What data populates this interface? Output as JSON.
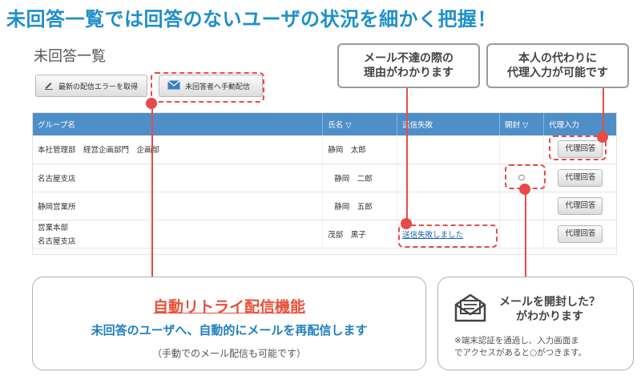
{
  "headline": "未回答一覧では回答のないユーザの状況を細かく把握！",
  "panel": {
    "title": "未回答一覧",
    "buttons": {
      "get_errors": "最新の配信エラーを取得",
      "manual_send": "未回答者へ手動配信"
    }
  },
  "table": {
    "headers": {
      "group": "グループ名",
      "name": "氏名 ▽",
      "fail": "送信失敗",
      "opened": "開封 ▽",
      "proxy": "代理入力"
    },
    "rows": [
      {
        "group_line1": "本社管理部　経営企画部門　企画部",
        "group_line2": "",
        "name": "静岡　太郎",
        "fail": "",
        "opened": "",
        "proxy": "代理回答"
      },
      {
        "group_line1": "名古屋支店",
        "group_line2": "",
        "name": "静岡　二郎",
        "fail": "",
        "opened": "○",
        "proxy": "代理回答"
      },
      {
        "group_line1": "静岡営業所",
        "group_line2": "",
        "name": "静岡　五郎",
        "fail": "",
        "opened": "",
        "proxy": "代理回答"
      },
      {
        "group_line1": "営業本部",
        "group_line2": "名古屋支店",
        "name": "茂部　黒子",
        "fail": "送信失敗しました",
        "opened": "",
        "proxy": "代理回答"
      }
    ]
  },
  "callouts": {
    "fail_reason_line1": "メール不達の際の",
    "fail_reason_line2": "理由がわかります",
    "proxy_line1": "本人の代わりに",
    "proxy_line2": "代理入力が可能です"
  },
  "retry_box": {
    "title": "自動リトライ配信機能",
    "subtitle": "未回答のユーザへ、自動的にメールを再配信します",
    "note": "（手動でのメール配信も可能です）"
  },
  "open_box": {
    "title_line1": "メールを開封した？",
    "title_line2": "がわかります",
    "note_line1": "※端末認証を通過し、入力画面ま",
    "note_line2": "でアクセスがあると○がつきます。"
  },
  "colors": {
    "accent_blue": "#1f8fc9",
    "table_header": "#4f8fc8",
    "highlight_red": "#e84a4a",
    "retry_title_red": "#e8503a",
    "subtitle_blue": "#1f7fc0"
  }
}
